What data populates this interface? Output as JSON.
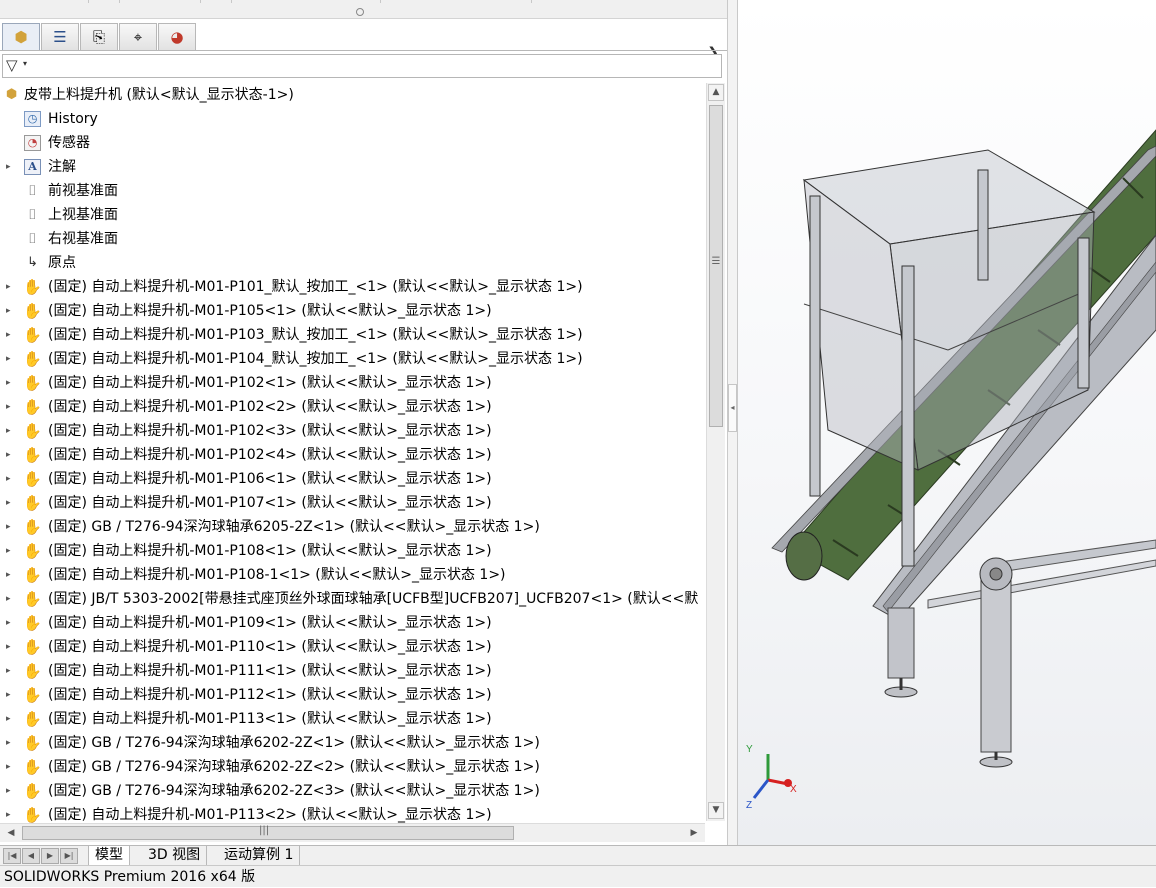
{
  "panel_tabs": [
    {
      "name": "featuremanager-tab-icon",
      "glyph": "⬢"
    },
    {
      "name": "propertymanager-tab-icon",
      "glyph": "☰"
    },
    {
      "name": "configurationmanager-tab-icon",
      "glyph": "⎘"
    },
    {
      "name": "dimxpert-tab-icon",
      "glyph": "⌖"
    },
    {
      "name": "displaymanager-tab-icon",
      "glyph": "◕"
    }
  ],
  "filter": {
    "icon": "filter-icon",
    "glyph": "▽",
    "arrow": "▾"
  },
  "tree": {
    "root": {
      "label": "皮带上料提升机 (默认<默认_显示状态-1>)",
      "icon": "assembly-icon",
      "glyph": "⬢"
    },
    "items": [
      {
        "label": "History",
        "icon": "history-icon",
        "glyph": "◷",
        "cls": "ic-hist",
        "expand": ""
      },
      {
        "label": "传感器",
        "icon": "sensor-icon",
        "glyph": "◔",
        "cls": "ic-sensor",
        "expand": ""
      },
      {
        "label": "注解",
        "icon": "annotations-icon",
        "glyph": "A",
        "cls": "ic-anno",
        "expand": "▸"
      },
      {
        "label": "前视基准面",
        "icon": "plane-icon",
        "glyph": "⌷",
        "cls": "ic-plane",
        "expand": ""
      },
      {
        "label": "上视基准面",
        "icon": "plane-icon",
        "glyph": "⌷",
        "cls": "ic-plane",
        "expand": ""
      },
      {
        "label": "右视基准面",
        "icon": "plane-icon",
        "glyph": "⌷",
        "cls": "ic-plane",
        "expand": ""
      },
      {
        "label": "原点",
        "icon": "origin-icon",
        "glyph": "↳",
        "cls": "ic-origin",
        "expand": ""
      },
      {
        "label": "(固定) 自动上料提升机-M01-P101_默认_按加工_<1> (默认<<默认>_显示状态 1>)",
        "icon": "part-icon",
        "glyph": "✋",
        "cls": "ic-part",
        "expand": "▸"
      },
      {
        "label": "(固定) 自动上料提升机-M01-P105<1> (默认<<默认>_显示状态 1>)",
        "icon": "part-icon",
        "glyph": "✋",
        "cls": "ic-part",
        "expand": "▸"
      },
      {
        "label": "(固定) 自动上料提升机-M01-P103_默认_按加工_<1> (默认<<默认>_显示状态 1>)",
        "icon": "part-icon",
        "glyph": "✋",
        "cls": "ic-part",
        "expand": "▸"
      },
      {
        "label": "(固定) 自动上料提升机-M01-P104_默认_按加工_<1> (默认<<默认>_显示状态 1>)",
        "icon": "part-icon",
        "glyph": "✋",
        "cls": "ic-part",
        "expand": "▸"
      },
      {
        "label": "(固定) 自动上料提升机-M01-P102<1> (默认<<默认>_显示状态 1>)",
        "icon": "part-icon",
        "glyph": "✋",
        "cls": "ic-part",
        "expand": "▸"
      },
      {
        "label": "(固定) 自动上料提升机-M01-P102<2> (默认<<默认>_显示状态 1>)",
        "icon": "part-icon",
        "glyph": "✋",
        "cls": "ic-part",
        "expand": "▸"
      },
      {
        "label": "(固定) 自动上料提升机-M01-P102<3> (默认<<默认>_显示状态 1>)",
        "icon": "part-icon",
        "glyph": "✋",
        "cls": "ic-part",
        "expand": "▸"
      },
      {
        "label": "(固定) 自动上料提升机-M01-P102<4> (默认<<默认>_显示状态 1>)",
        "icon": "part-icon",
        "glyph": "✋",
        "cls": "ic-part",
        "expand": "▸"
      },
      {
        "label": "(固定) 自动上料提升机-M01-P106<1> (默认<<默认>_显示状态 1>)",
        "icon": "part-icon",
        "glyph": "✋",
        "cls": "ic-part",
        "expand": "▸"
      },
      {
        "label": "(固定) 自动上料提升机-M01-P107<1> (默认<<默认>_显示状态 1>)",
        "icon": "part-icon",
        "glyph": "✋",
        "cls": "ic-part",
        "expand": "▸"
      },
      {
        "label": "(固定) GB / T276-94深沟球轴承6205-2Z<1> (默认<<默认>_显示状态 1>)",
        "icon": "part-icon",
        "glyph": "✋",
        "cls": "ic-part",
        "expand": "▸"
      },
      {
        "label": "(固定) 自动上料提升机-M01-P108<1> (默认<<默认>_显示状态 1>)",
        "icon": "part-icon",
        "glyph": "✋",
        "cls": "ic-part",
        "expand": "▸"
      },
      {
        "label": "(固定) 自动上料提升机-M01-P108-1<1> (默认<<默认>_显示状态 1>)",
        "icon": "part-icon",
        "glyph": "✋",
        "cls": "ic-part",
        "expand": "▸"
      },
      {
        "label": "(固定) JB/T 5303-2002[带悬挂式座顶丝外球面球轴承[UCFB型]UCFB207]_UCFB207<1> (默认<<默",
        "icon": "part-icon",
        "glyph": "✋",
        "cls": "ic-part",
        "expand": "▸"
      },
      {
        "label": "(固定) 自动上料提升机-M01-P109<1> (默认<<默认>_显示状态 1>)",
        "icon": "part-icon",
        "glyph": "✋",
        "cls": "ic-part",
        "expand": "▸"
      },
      {
        "label": "(固定) 自动上料提升机-M01-P110<1> (默认<<默认>_显示状态 1>)",
        "icon": "part-icon",
        "glyph": "✋",
        "cls": "ic-part",
        "expand": "▸"
      },
      {
        "label": "(固定) 自动上料提升机-M01-P111<1> (默认<<默认>_显示状态 1>)",
        "icon": "part-icon",
        "glyph": "✋",
        "cls": "ic-part",
        "expand": "▸"
      },
      {
        "label": "(固定) 自动上料提升机-M01-P112<1> (默认<<默认>_显示状态 1>)",
        "icon": "part-icon",
        "glyph": "✋",
        "cls": "ic-part",
        "expand": "▸"
      },
      {
        "label": "(固定) 自动上料提升机-M01-P113<1> (默认<<默认>_显示状态 1>)",
        "icon": "part-icon",
        "glyph": "✋",
        "cls": "ic-part",
        "expand": "▸"
      },
      {
        "label": "(固定) GB / T276-94深沟球轴承6202-2Z<1> (默认<<默认>_显示状态 1>)",
        "icon": "part-icon",
        "glyph": "✋",
        "cls": "ic-part",
        "expand": "▸"
      },
      {
        "label": "(固定) GB / T276-94深沟球轴承6202-2Z<2> (默认<<默认>_显示状态 1>)",
        "icon": "part-icon",
        "glyph": "✋",
        "cls": "ic-part",
        "expand": "▸"
      },
      {
        "label": "(固定) GB / T276-94深沟球轴承6202-2Z<3> (默认<<默认>_显示状态 1>)",
        "icon": "part-icon",
        "glyph": "✋",
        "cls": "ic-part",
        "expand": "▸"
      },
      {
        "label": "(固定) 自动上料提升机-M01-P113<2> (默认<<默认>_显示状态 1>)",
        "icon": "part-icon",
        "glyph": "✋",
        "cls": "ic-part",
        "expand": "▸"
      }
    ]
  },
  "scrollbar": {
    "up": "▲",
    "down": "▼",
    "grip": "☰",
    "left": "◀",
    "right": "▶",
    "hgrip": "|||"
  },
  "divider_glyph": "◂",
  "bottom_nav": [
    "|◀",
    "◀",
    "▶",
    "▶|"
  ],
  "bottom_tabs": [
    {
      "label": "模型",
      "active": true
    },
    {
      "label": "3D 视图",
      "active": false
    },
    {
      "label": "运动算例 1",
      "active": false
    }
  ],
  "triad": {
    "x": "X",
    "y": "Y",
    "z": "Z"
  },
  "colors": {
    "belt": "#4f6e3e",
    "frame": "#b9bcc3",
    "hopper": "#a9acb5",
    "x_axis": "#d62020",
    "y_axis": "#2e9a3a",
    "z_axis": "#2b56c8"
  },
  "status_bar": {
    "text": "SOLIDWORKS Premium 2016 x64 版"
  }
}
